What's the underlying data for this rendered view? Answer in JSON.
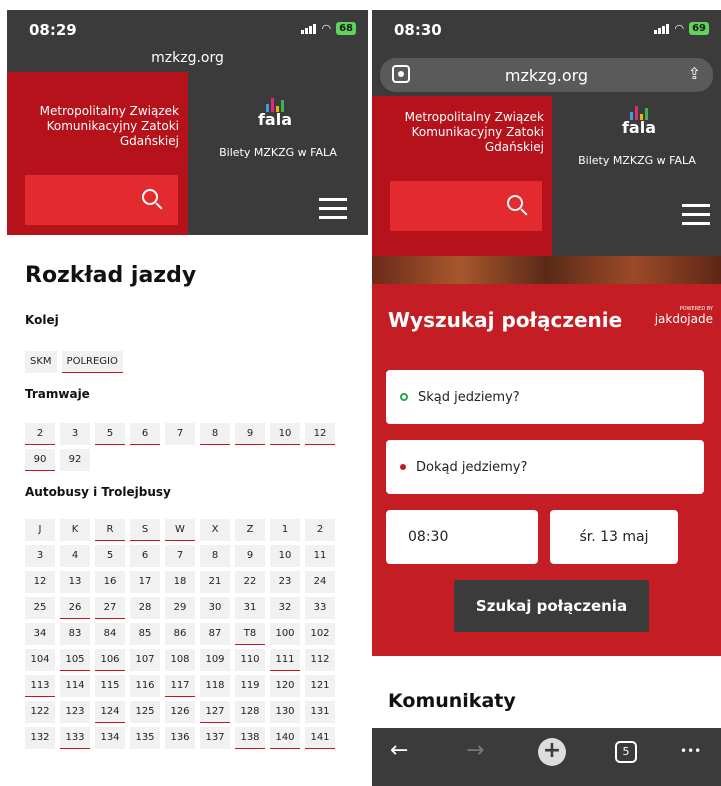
{
  "left": {
    "status": {
      "time": "08:29",
      "battery": "68"
    },
    "url": "mzkzg.org",
    "header": {
      "brand": "Metropolitalny Związek Komunikacyjny Zatoki Gdańskiej",
      "logo": "fala",
      "tickets": "Bilety MZKZG w FALA"
    },
    "page_title": "Rozkład jazdy",
    "sections": {
      "rail": {
        "title": "Kolej",
        "items": [
          {
            "label": "SKM",
            "u": false
          },
          {
            "label": "POLREGIO",
            "u": true
          }
        ]
      },
      "tram": {
        "title": "Tramwaje",
        "items": [
          {
            "label": "2",
            "u": true
          },
          {
            "label": "3",
            "u": false
          },
          {
            "label": "5",
            "u": true
          },
          {
            "label": "6",
            "u": true
          },
          {
            "label": "7",
            "u": false
          },
          {
            "label": "8",
            "u": true
          },
          {
            "label": "9",
            "u": true
          },
          {
            "label": "10",
            "u": true
          },
          {
            "label": "12",
            "u": true
          },
          {
            "label": "90",
            "u": true
          },
          {
            "label": "92",
            "u": false
          }
        ]
      },
      "bus": {
        "title": "Autobusy i Trolejbusy",
        "items": [
          {
            "label": "J",
            "u": false
          },
          {
            "label": "K",
            "u": false
          },
          {
            "label": "R",
            "u": true
          },
          {
            "label": "S",
            "u": true
          },
          {
            "label": "W",
            "u": true
          },
          {
            "label": "X",
            "u": false
          },
          {
            "label": "Z",
            "u": false
          },
          {
            "label": "1",
            "u": false
          },
          {
            "label": "2",
            "u": false
          },
          {
            "label": "3",
            "u": false
          },
          {
            "label": "4",
            "u": false
          },
          {
            "label": "5",
            "u": false
          },
          {
            "label": "6",
            "u": false
          },
          {
            "label": "7",
            "u": false
          },
          {
            "label": "8",
            "u": false
          },
          {
            "label": "9",
            "u": false
          },
          {
            "label": "10",
            "u": false
          },
          {
            "label": "11",
            "u": false
          },
          {
            "label": "12",
            "u": false
          },
          {
            "label": "13",
            "u": false
          },
          {
            "label": "16",
            "u": false
          },
          {
            "label": "17",
            "u": false
          },
          {
            "label": "18",
            "u": false
          },
          {
            "label": "21",
            "u": false
          },
          {
            "label": "22",
            "u": false
          },
          {
            "label": "23",
            "u": false
          },
          {
            "label": "24",
            "u": false
          },
          {
            "label": "25",
            "u": false
          },
          {
            "label": "26",
            "u": true
          },
          {
            "label": "27",
            "u": true
          },
          {
            "label": "28",
            "u": false
          },
          {
            "label": "29",
            "u": false
          },
          {
            "label": "30",
            "u": false
          },
          {
            "label": "31",
            "u": false
          },
          {
            "label": "32",
            "u": false
          },
          {
            "label": "33",
            "u": false
          },
          {
            "label": "34",
            "u": false
          },
          {
            "label": "83",
            "u": false
          },
          {
            "label": "84",
            "u": false
          },
          {
            "label": "85",
            "u": false
          },
          {
            "label": "86",
            "u": false
          },
          {
            "label": "87",
            "u": false
          },
          {
            "label": "T8",
            "u": true
          },
          {
            "label": "100",
            "u": false
          },
          {
            "label": "102",
            "u": false
          },
          {
            "label": "104",
            "u": false
          },
          {
            "label": "105",
            "u": true
          },
          {
            "label": "106",
            "u": true
          },
          {
            "label": "107",
            "u": false
          },
          {
            "label": "108",
            "u": false
          },
          {
            "label": "109",
            "u": false
          },
          {
            "label": "110",
            "u": false
          },
          {
            "label": "111",
            "u": true
          },
          {
            "label": "112",
            "u": false
          },
          {
            "label": "113",
            "u": true
          },
          {
            "label": "114",
            "u": false
          },
          {
            "label": "115",
            "u": false
          },
          {
            "label": "116",
            "u": false
          },
          {
            "label": "117",
            "u": true
          },
          {
            "label": "118",
            "u": false
          },
          {
            "label": "119",
            "u": false
          },
          {
            "label": "120",
            "u": false
          },
          {
            "label": "121",
            "u": false
          },
          {
            "label": "122",
            "u": false
          },
          {
            "label": "123",
            "u": false
          },
          {
            "label": "124",
            "u": true
          },
          {
            "label": "125",
            "u": false
          },
          {
            "label": "126",
            "u": false
          },
          {
            "label": "127",
            "u": true
          },
          {
            "label": "128",
            "u": false
          },
          {
            "label": "130",
            "u": false
          },
          {
            "label": "131",
            "u": false
          },
          {
            "label": "132",
            "u": false
          },
          {
            "label": "133",
            "u": true
          },
          {
            "label": "134",
            "u": false
          },
          {
            "label": "135",
            "u": false
          },
          {
            "label": "136",
            "u": false
          },
          {
            "label": "137",
            "u": false
          },
          {
            "label": "138",
            "u": true
          },
          {
            "label": "140",
            "u": true
          },
          {
            "label": "141",
            "u": true
          }
        ]
      }
    }
  },
  "right": {
    "status": {
      "time": "08:30",
      "battery": "69"
    },
    "url": "mzkzg.org",
    "header": {
      "brand": "Metropolitalny Związek Komunikacyjny Zatoki Gdańskiej",
      "logo": "fala",
      "tickets": "Bilety MZKZG w FALA"
    },
    "planner": {
      "title": "Wyszukaj połączenie",
      "powered_by": "POWERED BY",
      "provider": "jakdojade",
      "from_placeholder": "Skąd jedziemy?",
      "to_placeholder": "Dokąd jedziemy?",
      "time": "08:30",
      "date": "śr. 13 maj",
      "search_button": "Szukaj połączenia"
    },
    "news_title": "Komunikaty",
    "toolbar": {
      "back": "←",
      "forward": "→",
      "new_tab": "+",
      "tab_count": "5",
      "more": "•••"
    }
  },
  "colors": {
    "brand_red": "#b5121b",
    "accent_red": "#e32b2f",
    "dark": "#3b3b3b"
  },
  "icons": [
    "search-icon",
    "hamburger-icon",
    "share-icon",
    "site-settings-icon",
    "back-icon",
    "forward-icon",
    "new-tab-icon",
    "tabs-icon",
    "more-icon"
  ]
}
